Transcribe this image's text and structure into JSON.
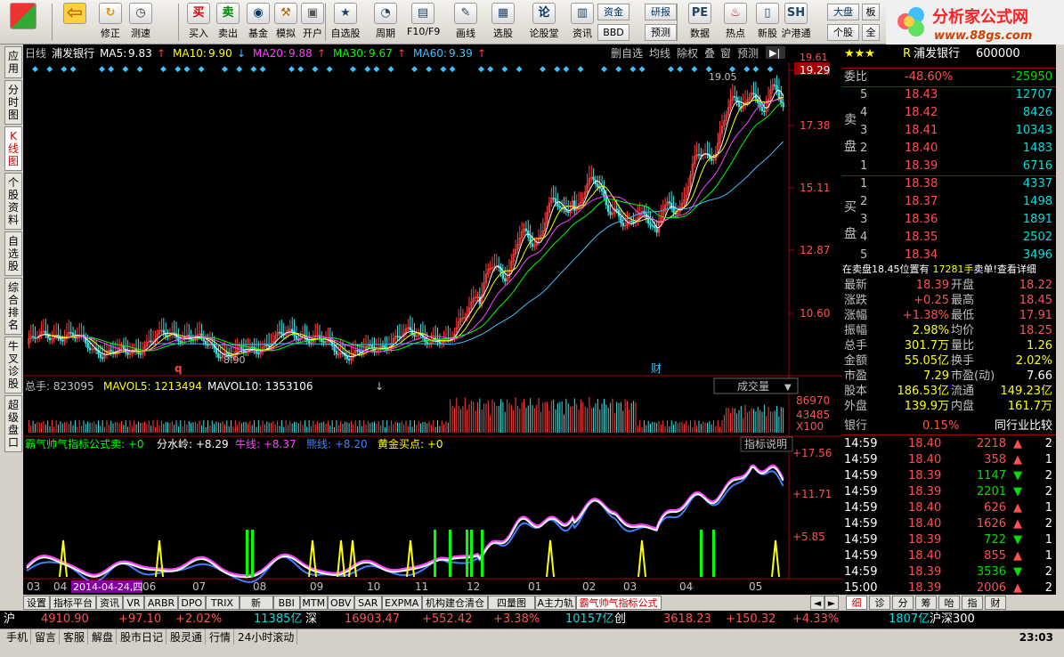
{
  "toolbar": {
    "items": [
      {
        "label": "",
        "icon": "windows-logo-icon"
      },
      {
        "label": "",
        "icon": "back-arrow-icon"
      },
      {
        "label": "修正",
        "icon": "refresh-icon"
      },
      {
        "label": "测速",
        "icon": "clock-icon"
      },
      {
        "label": "买入",
        "icon": "buy-icon",
        "glyph": "买"
      },
      {
        "label": "卖出",
        "icon": "sell-icon",
        "glyph": "卖"
      },
      {
        "label": "基金",
        "icon": "fund-icon"
      },
      {
        "label": "模拟",
        "icon": "hammer-icon"
      },
      {
        "label": "开户",
        "icon": "lock-icon"
      },
      {
        "label": "自选股",
        "icon": "star-folder-icon"
      },
      {
        "label": "周期",
        "icon": "clock-menu-icon"
      },
      {
        "label": "F10/F9",
        "icon": "document-icon"
      },
      {
        "label": "画线",
        "icon": "pencil-icon"
      },
      {
        "label": "选股",
        "icon": "screen-icon"
      },
      {
        "label": "论股堂",
        "icon": "talk-icon",
        "glyph": "论"
      },
      {
        "label": "资讯",
        "icon": "news-icon"
      },
      {
        "label": "数据",
        "icon": "pe-data-icon",
        "glyph": "PE"
      },
      {
        "label": "热点",
        "icon": "fire-icon"
      },
      {
        "label": "新股",
        "icon": "ipo-icon"
      },
      {
        "label": "沪港通",
        "icon": "sh-hk-icon",
        "glyph": "SH"
      }
    ],
    "mini": [
      "资金",
      "BBD",
      "研报",
      "预测",
      "大盘",
      "个股",
      "板",
      "全"
    ]
  },
  "logo": {
    "title": "分析家公式网",
    "url": "www.88gs.com"
  },
  "side_tabs": [
    "应用",
    "分时图",
    "K线图",
    "个股资料",
    "自选股",
    "综合排名",
    "牛叉诊股",
    "超级盘口"
  ],
  "chart": {
    "period": "日线",
    "stock": "浦发银行",
    "ma": [
      {
        "name": "MA5:",
        "value": "9.83",
        "arrow": "↑",
        "color": "#ffffff"
      },
      {
        "name": "MA10:",
        "value": "9.90",
        "arrow": "↓",
        "color": "#ffff00"
      },
      {
        "name": "MA20:",
        "value": "9.88",
        "arrow": "↑",
        "color": "#ff40ff"
      },
      {
        "name": "MA30:",
        "value": "9.67",
        "arrow": "↑",
        "color": "#00ff00"
      },
      {
        "name": "MA60:",
        "value": "9.39",
        "arrow": "↑",
        "color": "#40c0ff"
      }
    ],
    "top_buttons": [
      "删自选",
      "均线",
      "除权",
      "叠",
      "窗",
      "预测"
    ],
    "price_labels": [
      "19.29",
      "17.38",
      "15.11",
      "12.87",
      "10.60"
    ],
    "top_price": "19.61",
    "peak_label": "19.05",
    "low_label": "8.90",
    "q_mark": "q",
    "cai_mark": "财",
    "vol": {
      "total_label": "总手: 823095",
      "mavol5": "MAVOL5: 1213494",
      "mavol10": "MAVOL10: 1353106",
      "dropdown": "成交量",
      "labels": [
        "86970",
        "43485",
        "X100"
      ]
    },
    "ind": {
      "name": "霸气帅气指标公式",
      "sell": "卖: +0",
      "fsl": "分水岭: +8.29",
      "niu": "牛线: +8.37",
      "xiong": "熊线: +8.20",
      "gold": "黄金买点: +0",
      "explain": "指标说明",
      "labels": [
        "+17.56",
        "+11.71",
        "+5.85"
      ]
    },
    "months": [
      "03",
      "04",
      "06",
      "07",
      "08",
      "09",
      "10",
      "11",
      "12",
      "01",
      "02",
      "03",
      "04",
      "05"
    ],
    "date_badge": "2014-04-24,四"
  },
  "right": {
    "stars": "★★★",
    "r": "R",
    "name": "浦发银行",
    "code": "600000",
    "weibi": {
      "label": "委比",
      "pct": "-48.60%",
      "diff": "-25950"
    },
    "sell": [
      {
        "i": "5",
        "p": "18.43",
        "v": "12707"
      },
      {
        "i": "4",
        "p": "18.42",
        "v": "8426"
      },
      {
        "i": "3",
        "p": "18.41",
        "v": "10343"
      },
      {
        "i": "2",
        "p": "18.40",
        "v": "1483"
      },
      {
        "i": "1",
        "p": "18.39",
        "v": "6716"
      }
    ],
    "buy": [
      {
        "i": "1",
        "p": "18.38",
        "v": "4337"
      },
      {
        "i": "2",
        "p": "18.37",
        "v": "1498"
      },
      {
        "i": "3",
        "p": "18.36",
        "v": "1891"
      },
      {
        "i": "4",
        "p": "18.35",
        "v": "2502"
      },
      {
        "i": "5",
        "p": "18.34",
        "v": "3496"
      }
    ],
    "sell_label": "卖盘",
    "buy_label": "买盘",
    "notice": {
      "text": "在卖盘18.45位置有",
      "vol": "17281手",
      "tail": "卖单!",
      "link": "查看详细"
    },
    "quote": [
      {
        "l": "最新",
        "v": "18.39",
        "l2": "开盘",
        "v2": "18.22"
      },
      {
        "l": "涨跌",
        "v": "+0.25",
        "l2": "最高",
        "v2": "18.45"
      },
      {
        "l": "涨幅",
        "v": "+1.38%",
        "l2": "最低",
        "v2": "17.91"
      },
      {
        "l": "振幅",
        "v": "2.98%",
        "l2": "均价",
        "v2": "18.25"
      },
      {
        "l": "总手",
        "v": "301.7万",
        "l2": "量比",
        "v2": "1.26"
      },
      {
        "l": "金额",
        "v": "55.05亿",
        "l2": "换手",
        "v2": "2.02%"
      },
      {
        "l": "市盈",
        "v": "7.29",
        "l2": "市盈(动)",
        "v2": "7.66"
      },
      {
        "l": "股本",
        "v": "186.53亿",
        "l2": "流通",
        "v2": "149.23亿"
      },
      {
        "l": "外盘",
        "v": "139.9万",
        "l2": "内盘",
        "v2": "161.7万"
      }
    ],
    "industry": {
      "name": "银行",
      "pct": "0.15%",
      "compare": "同行业比较"
    },
    "ticks": [
      {
        "t": "14:59",
        "p": "18.40",
        "v": "2218",
        "d": "up",
        "n": "2"
      },
      {
        "t": "14:59",
        "p": "18.40",
        "v": "358",
        "d": "up",
        "n": "1"
      },
      {
        "t": "14:59",
        "p": "18.39",
        "v": "1147",
        "d": "down",
        "n": "2"
      },
      {
        "t": "14:59",
        "p": "18.39",
        "v": "2201",
        "d": "down",
        "n": "2"
      },
      {
        "t": "14:59",
        "p": "18.40",
        "v": "626",
        "d": "up",
        "n": "1"
      },
      {
        "t": "14:59",
        "p": "18.40",
        "v": "1626",
        "d": "up",
        "n": "2"
      },
      {
        "t": "14:59",
        "p": "18.39",
        "v": "722",
        "d": "down",
        "n": "1"
      },
      {
        "t": "14:59",
        "p": "18.40",
        "v": "855",
        "d": "up",
        "n": "1"
      },
      {
        "t": "14:59",
        "p": "18.39",
        "v": "3536",
        "d": "down",
        "n": "2"
      },
      {
        "t": "15:00",
        "p": "18.39",
        "v": "2006",
        "d": "up",
        "n": "2"
      }
    ],
    "bottom_tabs": [
      "细",
      "诊",
      "分",
      "筹",
      "咍",
      "指",
      "财"
    ]
  },
  "bottom_tabs": [
    "设置",
    "指标平台",
    "资讯",
    "VR",
    "ARBR",
    "DPO",
    "TRIX",
    "新DMA",
    "BBI",
    "MTM",
    "OBV",
    "SAR",
    "EXPMA",
    "机构建仓清仓",
    "四量图NEW",
    "A主力轨迹",
    "霸气帅气指标公式"
  ],
  "status": {
    "sh": "沪",
    "sh_idx": "4910.90",
    "sh_chg": "+97.10",
    "sh_pct": "+2.02%",
    "sh_amt": "11385亿",
    "sz": "深",
    "sz_idx": "16903.47",
    "sz_chg": "+552.42",
    "sz_pct": "+3.38%",
    "sz_amt": "10157亿",
    "cy": "创",
    "cy_idx": "3618.23",
    "cy_chg": "+150.32",
    "cy_pct": "+4.33%",
    "hs_amt": "1807亿",
    "hs": "沪深300"
  },
  "status2": [
    "手机",
    "留言",
    "客服",
    "解盘",
    "股市日记",
    "股灵通",
    "行情",
    "24小时滚动"
  ],
  "clock": "23:03"
}
